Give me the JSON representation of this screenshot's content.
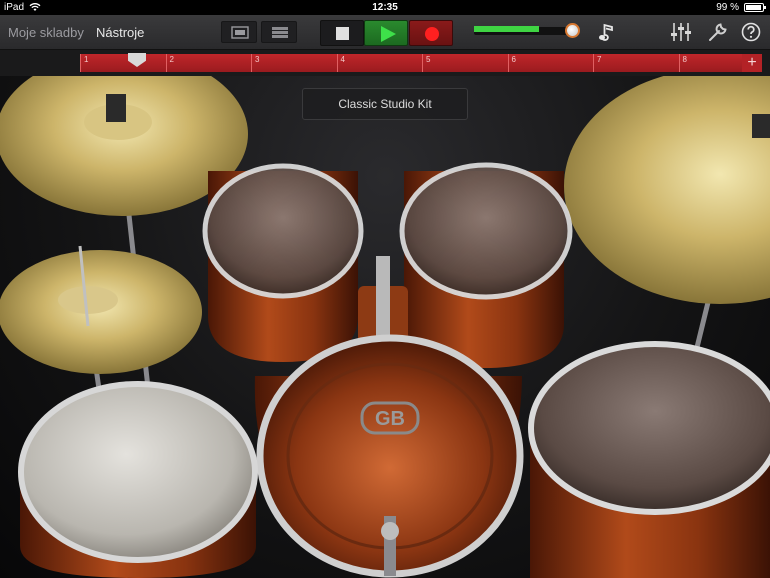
{
  "status_bar": {
    "device": "iPad",
    "time": "12:35",
    "battery": "99 %"
  },
  "toolbar": {
    "my_songs": "Moje skladby",
    "instruments": "Nástroje",
    "volume_level": 0.68
  },
  "ruler": {
    "bars": [
      "1",
      "2",
      "3",
      "4",
      "5",
      "6",
      "7",
      "8"
    ],
    "add_symbol": "+"
  },
  "kit": {
    "name": "Classic Studio Kit",
    "bass_drum_logo": "GB"
  },
  "colors": {
    "ruler_red": "#b52226",
    "play_green": "#3ee04a",
    "record_red": "#ff2020",
    "volume_green": "#3fd443"
  },
  "icons": [
    "wifi-icon",
    "battery-icon",
    "tracks-view-icon",
    "instrument-view-icon",
    "stop-icon",
    "play-icon",
    "record-icon",
    "metronome-icon",
    "mixer-icon",
    "wrench-icon",
    "help-icon"
  ]
}
